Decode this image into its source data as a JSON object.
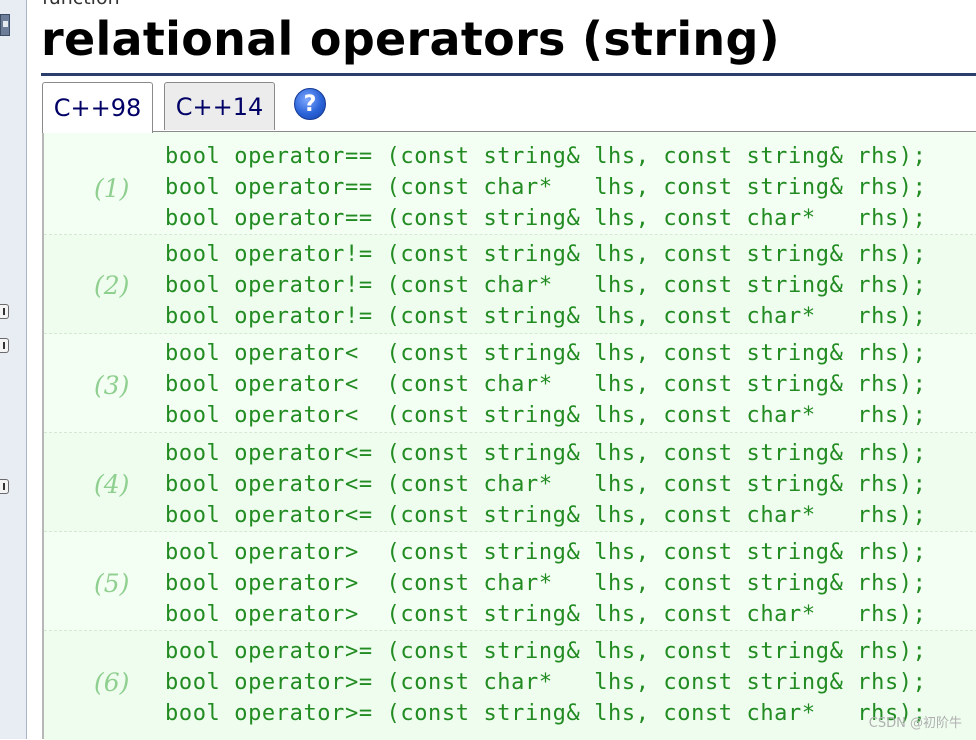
{
  "page": {
    "kind_label": "function",
    "title": "relational operators (string)"
  },
  "tabs": [
    {
      "label": "C++98",
      "active": true
    },
    {
      "label": "C++14",
      "active": false
    }
  ],
  "help_icon": {
    "glyph": "?",
    "icon": "help-icon"
  },
  "declarations": [
    {
      "num": "(1)",
      "lines": [
        "bool operator== (const string& lhs, const string& rhs);",
        "bool operator== (const char*   lhs, const string& rhs);",
        "bool operator== (const string& lhs, const char*   rhs);"
      ]
    },
    {
      "num": "(2)",
      "lines": [
        "bool operator!= (const string& lhs, const string& rhs);",
        "bool operator!= (const char*   lhs, const string& rhs);",
        "bool operator!= (const string& lhs, const char*   rhs);"
      ]
    },
    {
      "num": "(3)",
      "lines": [
        "bool operator<  (const string& lhs, const string& rhs);",
        "bool operator<  (const char*   lhs, const string& rhs);",
        "bool operator<  (const string& lhs, const char*   rhs);"
      ]
    },
    {
      "num": "(4)",
      "lines": [
        "bool operator<= (const string& lhs, const string& rhs);",
        "bool operator<= (const char*   lhs, const string& rhs);",
        "bool operator<= (const string& lhs, const char*   rhs);"
      ]
    },
    {
      "num": "(5)",
      "lines": [
        "bool operator>  (const string& lhs, const string& rhs);",
        "bool operator>  (const char*   lhs, const string& rhs);",
        "bool operator>  (const string& lhs, const char*   rhs);"
      ]
    },
    {
      "num": "(6)",
      "lines": [
        "bool operator>= (const string& lhs, const string& rhs);",
        "bool operator>= (const char*   lhs, const string& rhs);",
        "bool operator>= (const string& lhs, const char*   rhs);"
      ]
    }
  ],
  "watermark": "CSDN @初阶牛",
  "colors": {
    "code_green": "#228b22",
    "number_green": "#8fcf8f",
    "box_bg": "#f4fff4",
    "title_rule": "#2b3d6a",
    "tab_text": "#000066"
  }
}
